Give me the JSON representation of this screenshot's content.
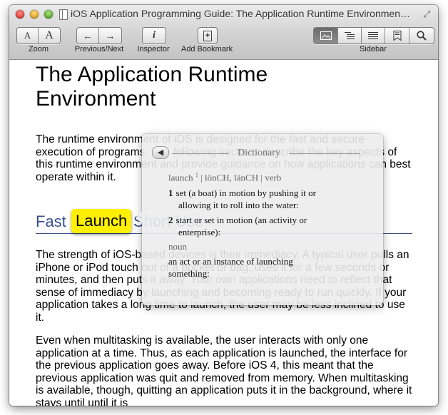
{
  "window": {
    "title": "iOS Application Programming Guide: The Application Runtime Environmen…"
  },
  "toolbar": {
    "zoom": {
      "label": "Zoom",
      "smaller": "A",
      "larger": "A"
    },
    "nav": {
      "label": "Previous/Next",
      "previous_icon": "←",
      "next_icon": "→"
    },
    "inspector": {
      "label": "Inspector",
      "icon": "i"
    },
    "bookmark": {
      "label": "Add Bookmark",
      "icon": "+"
    },
    "sidebar": {
      "label": "Sidebar",
      "active_index": 0
    },
    "search_icon": "⌕"
  },
  "document": {
    "title": "The Application Runtime Environment",
    "intro": "The runtime environment of iOS is designed for the fast and secure execution of programs. The following sections describe the key aspects of this runtime environment and provide guidance on how applications can best operate within it.",
    "section_heading_prefix": "Fast",
    "section_heading_highlight": "Launch",
    "section_heading_suffix": ", Short Use",
    "p1": "The strength of iOS-based devices is their immediacy. A typical user pulls an iPhone or iPod touch out of a pocket or bag, uses it for a few seconds or minutes, and then puts it away. Your own applications need to reflect that sense of immediacy by launching and becoming ready to run quickly. If your application takes a long time to launch, the user may be less inclined to use it.",
    "p2": "Even when multitasking is available, the user interacts with only one application at a time. Thus, as each application is launched, the interface for the previous application goes away. Before iOS 4, this meant that the previous application was quit and removed from memory. When multitasking is available, though, quitting an application puts it in the background, where it stays until until it is"
  },
  "dictionary": {
    "back_icon": "◀",
    "title": "Dictionary",
    "headword": "launch",
    "homograph": "1",
    "pronunciation": " | lônCH,  länCH | verb",
    "definitions": [
      {
        "num": "1",
        "line1": "set (a boat) in motion by pushing it or",
        "line2": "allowing it to roll into the water:"
      },
      {
        "num": "2",
        "line1": "start or set in motion (an activity or",
        "line2": "enterprise):"
      }
    ],
    "pos2": "noun",
    "noun_def_line1": "an act or an instance of launching",
    "noun_def_line2": "something:"
  }
}
